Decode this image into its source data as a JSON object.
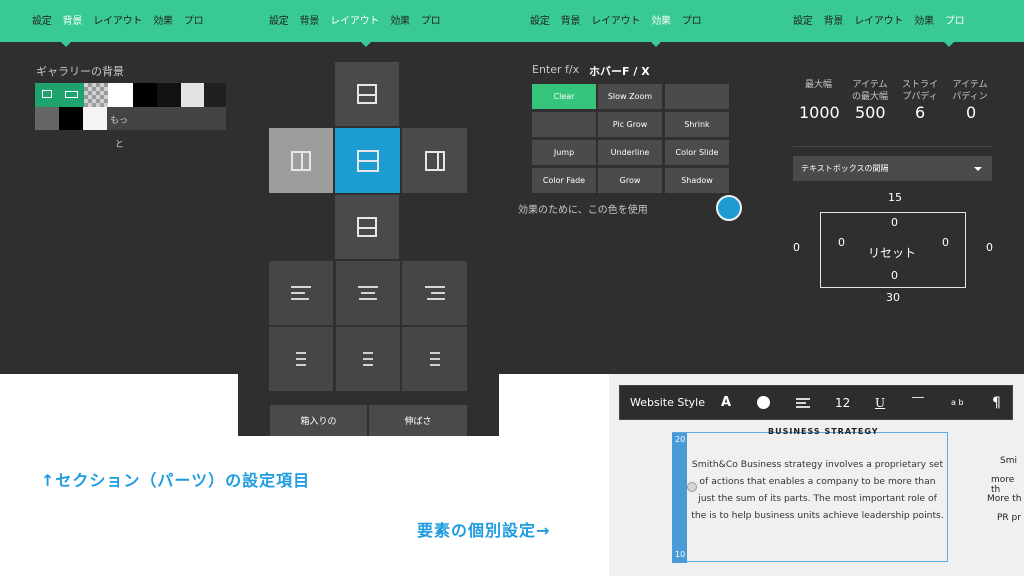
{
  "panel_background": {
    "tabs": [
      "設定",
      "背景",
      "レイアウト",
      "効果",
      "プロ"
    ],
    "active_tab": "背景",
    "label": "ギャラリーの背景",
    "more_text_1": "もっ",
    "more_text_2": "と"
  },
  "panel_layout": {
    "tabs": [
      "設定",
      "背景",
      "レイアウト",
      "効果",
      "プロ"
    ],
    "active_tab": "レイアウト",
    "buttons": [
      "箱入りの",
      "伸ばさ"
    ]
  },
  "panel_effects": {
    "tabs": [
      "設定",
      "背景",
      "レイアウト",
      "効果",
      "プロ"
    ],
    "active_tab": "効果",
    "enter_label": "Enter f/x",
    "hover_label": "ホバーF / X",
    "effects": [
      "Clear",
      "Slow Zoom",
      "",
      "",
      "Pic Grow",
      "Shrink",
      "Jump",
      "Underline",
      "Color Slide",
      "Color Fade",
      "Grow",
      "Shadow"
    ],
    "color_hint": "効果のために、この色を使用",
    "accent_color": "#1d9cd2"
  },
  "panel_pro": {
    "tabs": [
      "設定",
      "背景",
      "レイアウト",
      "効果",
      "プロ"
    ],
    "active_tab": "プロ",
    "headers": [
      "最大幅",
      "アイテム\nの最大幅",
      "ストライ\nプパディ",
      "アイテム\nパディン"
    ],
    "values": [
      "1000",
      "500",
      "6",
      "0"
    ],
    "dropdown": "テキストボックスの間隔",
    "spacing_top": "15",
    "spacing_bottom": "30",
    "spacing_left": "0",
    "spacing_right": "0",
    "inner_top": "0",
    "inner_bottom": "0",
    "inner_left": "0",
    "inner_right": "0",
    "reset_label": "リセット"
  },
  "toolbar": {
    "title": "Website Style",
    "font_icon": "A",
    "size": "12",
    "underline": "U",
    "ab_label": "a b"
  },
  "card": {
    "section_title": "BUSINESS STRATEGY",
    "body": "Smith&Co Business strategy involves a proprietary set of actions that enables a company to be more than just the sum of its parts. The most important role of the is to help business units achieve leadership points.",
    "top_num": "20",
    "bottom_num": "10",
    "right_fragment_1": "Smi",
    "right_fragment_2": "more th",
    "right_fragment_3": "More th",
    "right_fragment_4": "PR pr"
  },
  "captions": {
    "section": "↑セクション（パーツ）の設定項目",
    "element": "要素の個別設定→"
  }
}
